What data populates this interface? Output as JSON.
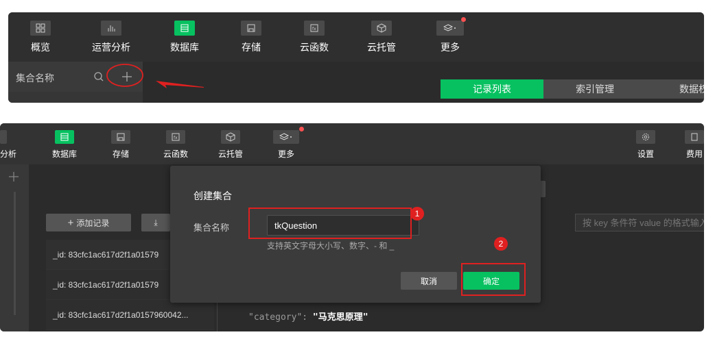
{
  "panel1": {
    "toolbar": [
      {
        "label": "概览",
        "icon": "grid-icon"
      },
      {
        "label": "运营分析",
        "icon": "bar-chart-icon"
      },
      {
        "label": "数据库",
        "icon": "database-icon",
        "active": true
      },
      {
        "label": "存储",
        "icon": "storage-icon"
      },
      {
        "label": "云函数",
        "icon": "function-icon"
      },
      {
        "label": "云托管",
        "icon": "cube-icon"
      },
      {
        "label": "更多",
        "icon": "layers-icon",
        "dot": true
      }
    ],
    "sidebar": {
      "label": "集合名称"
    },
    "tabs": [
      "记录列表",
      "索引管理",
      "数据权限"
    ]
  },
  "panel2": {
    "toolbar": [
      {
        "label": "分析",
        "icon": "bar-chart-icon"
      },
      {
        "label": "数据库",
        "icon": "database-icon",
        "active": true
      },
      {
        "label": "存储",
        "icon": "storage-icon"
      },
      {
        "label": "云函数",
        "icon": "function-icon"
      },
      {
        "label": "云托管",
        "icon": "cube-icon"
      },
      {
        "label": "更多",
        "icon": "layers-icon",
        "dot": true
      },
      {
        "label": "设置",
        "icon": "gear-icon"
      },
      {
        "label": "费用",
        "icon": "bill-icon"
      }
    ],
    "add_record_label": "添加记录",
    "filter_placeholder": "按 key 条件符 value 的格式输入",
    "records": [
      "_id: 83cfc1ac617d2f1a01579",
      "_id: 83cfc1ac617d2f1a01579",
      "_id: 83cfc1ac617d2f1a0157960042..."
    ],
    "json_preview": {
      "key": "\"category\":",
      "value": "\"马克思原理\""
    }
  },
  "dialog": {
    "title": "创建集合",
    "field_label": "集合名称",
    "field_value": "tkQuestion",
    "hint": "支持英文字母大小写、数字、- 和 _",
    "cancel_label": "取消",
    "ok_label": "确定"
  },
  "annotations": {
    "badge1": "1",
    "badge2": "2"
  },
  "colors": {
    "accent": "#07c160",
    "annotation": "#e02020"
  }
}
